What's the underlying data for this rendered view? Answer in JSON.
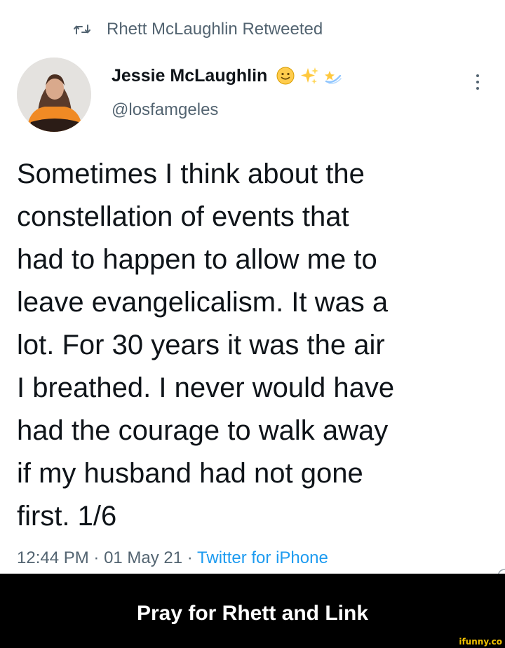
{
  "retweet": {
    "text": "Rhett McLaughlin Retweeted",
    "icon": "retweet-icon"
  },
  "author": {
    "display_name": "Jessie McLaughlin",
    "handle": "@losfamgeles",
    "name_emojis": [
      "slightly-smiling-face-icon",
      "sparkles-icon",
      "shooting-star-icon"
    ]
  },
  "tweet": {
    "lines": [
      "Sometimes I think about the",
      "constellation of events that",
      "had to happen to allow me to",
      "leave evangelicalism. It was a",
      "lot. For 30 years it was the air",
      "I breathed. I never would have",
      "had the courage to walk away",
      "if my husband had not gone",
      "first. 1/6"
    ]
  },
  "meta": {
    "time": "12:44 PM",
    "separator": " · ",
    "date": "01 May 21",
    "source": "Twitter for iPhone"
  },
  "caption": {
    "text": "Pray for Rhett and Link",
    "watermark": "ifunny.co"
  },
  "colors": {
    "text_primary": "#0f1419",
    "text_secondary": "#536471",
    "link": "#1d9bf0",
    "caption_bg": "#000000",
    "caption_text": "#ffffff",
    "watermark": "#f2c200"
  }
}
